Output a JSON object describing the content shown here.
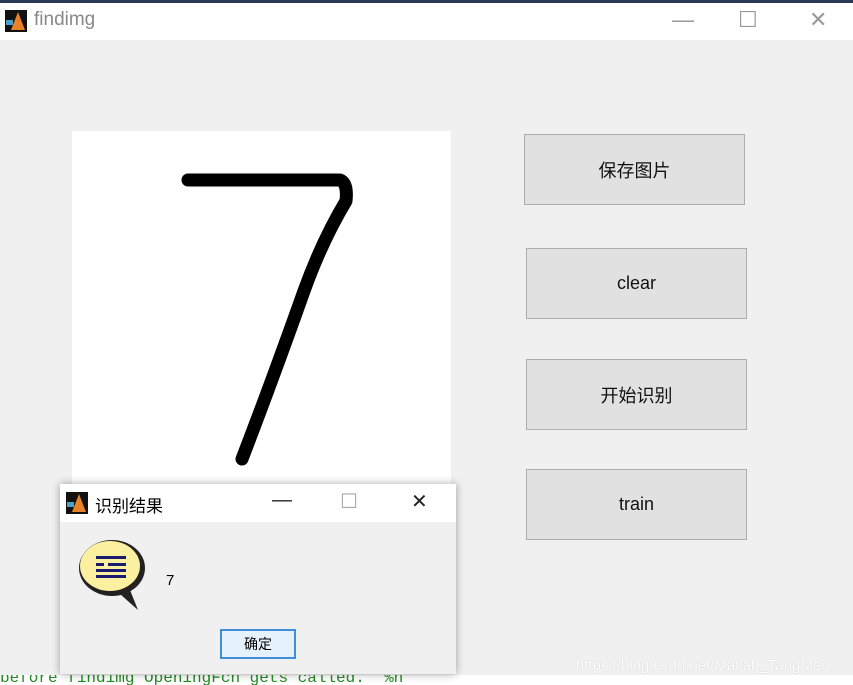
{
  "window": {
    "title": "findimg",
    "minimize": "—",
    "maximize": "☐",
    "close": "✕"
  },
  "buttons": [
    {
      "label": "保存图片"
    },
    {
      "label": "clear"
    },
    {
      "label": "开始识别"
    },
    {
      "label": "train"
    }
  ],
  "dialog": {
    "title": "识别结果",
    "minimize": "—",
    "maximize": "☐",
    "close": "✕",
    "message": "7",
    "ok_label": "确定",
    "icon": "help-speech-bubble-icon"
  },
  "background_editor_text": "before findimg OpeningFcn gets called.  %n",
  "watermark": "https://blog.csdn.net/Matlab_TangMen",
  "drawing": {
    "digit": "7"
  }
}
